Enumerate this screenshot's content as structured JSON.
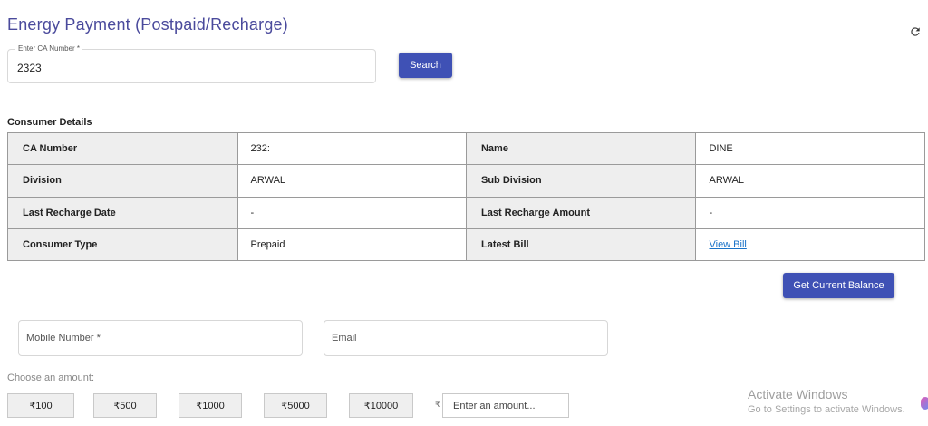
{
  "page": {
    "title": "Energy Payment (Postpaid/Recharge)"
  },
  "search": {
    "label": "Enter CA Number *",
    "value": "2323",
    "button": "Search"
  },
  "consumer": {
    "section_title": "Consumer Details",
    "rows": [
      [
        "CA Number",
        "232:",
        "Name",
        "DINE"
      ],
      [
        "Division",
        "ARWAL",
        "Sub Division",
        "ARWAL"
      ],
      [
        "Last Recharge Date",
        "-",
        "Last Recharge Amount",
        "-"
      ],
      [
        "Consumer Type",
        "Prepaid",
        "Latest Bill",
        "View Bill"
      ]
    ]
  },
  "balance_button": "Get Current Balance",
  "contact": {
    "mobile_placeholder": "Mobile Number *",
    "email_placeholder": "Email"
  },
  "amounts": {
    "label": "Choose an amount:",
    "options": [
      "₹100",
      "₹500",
      "₹1000",
      "₹5000",
      "₹10000"
    ],
    "currency_symbol": "₹",
    "custom_placeholder": "Enter an amount..."
  },
  "watermark": {
    "title": "Activate Windows",
    "subtitle": "Go to Settings to activate Windows."
  },
  "colors": {
    "primary": "#3f51b5",
    "title": "#4a4a9c",
    "link": "#1a73c8"
  }
}
